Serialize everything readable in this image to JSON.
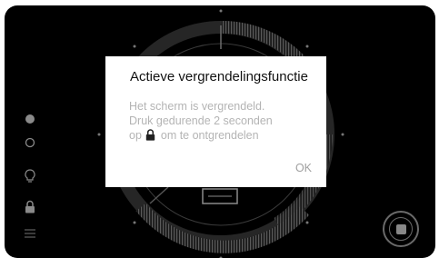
{
  "dialog": {
    "title": "Actieve vergrendelingsfunctie",
    "message_line1": "Het scherm is vergrendeld.",
    "message_line2": "Druk gedurende 2 seconden",
    "message_line3_prefix": "op",
    "message_line3_suffix": "om te ontgrendelen",
    "ok_label": "OK"
  },
  "sidebar": {
    "icons": [
      "dot-filled-icon",
      "dot-outline-icon",
      "lightbulb-icon",
      "lock-icon",
      "menu-icon"
    ]
  },
  "controls": {
    "stop_icon": "stop-icon"
  },
  "colors": {
    "background": "#000000",
    "dialog_background": "#ffffff",
    "dialog_title": "#111111",
    "dialog_text": "#b4b4b4",
    "icon_gray": "#888888"
  }
}
